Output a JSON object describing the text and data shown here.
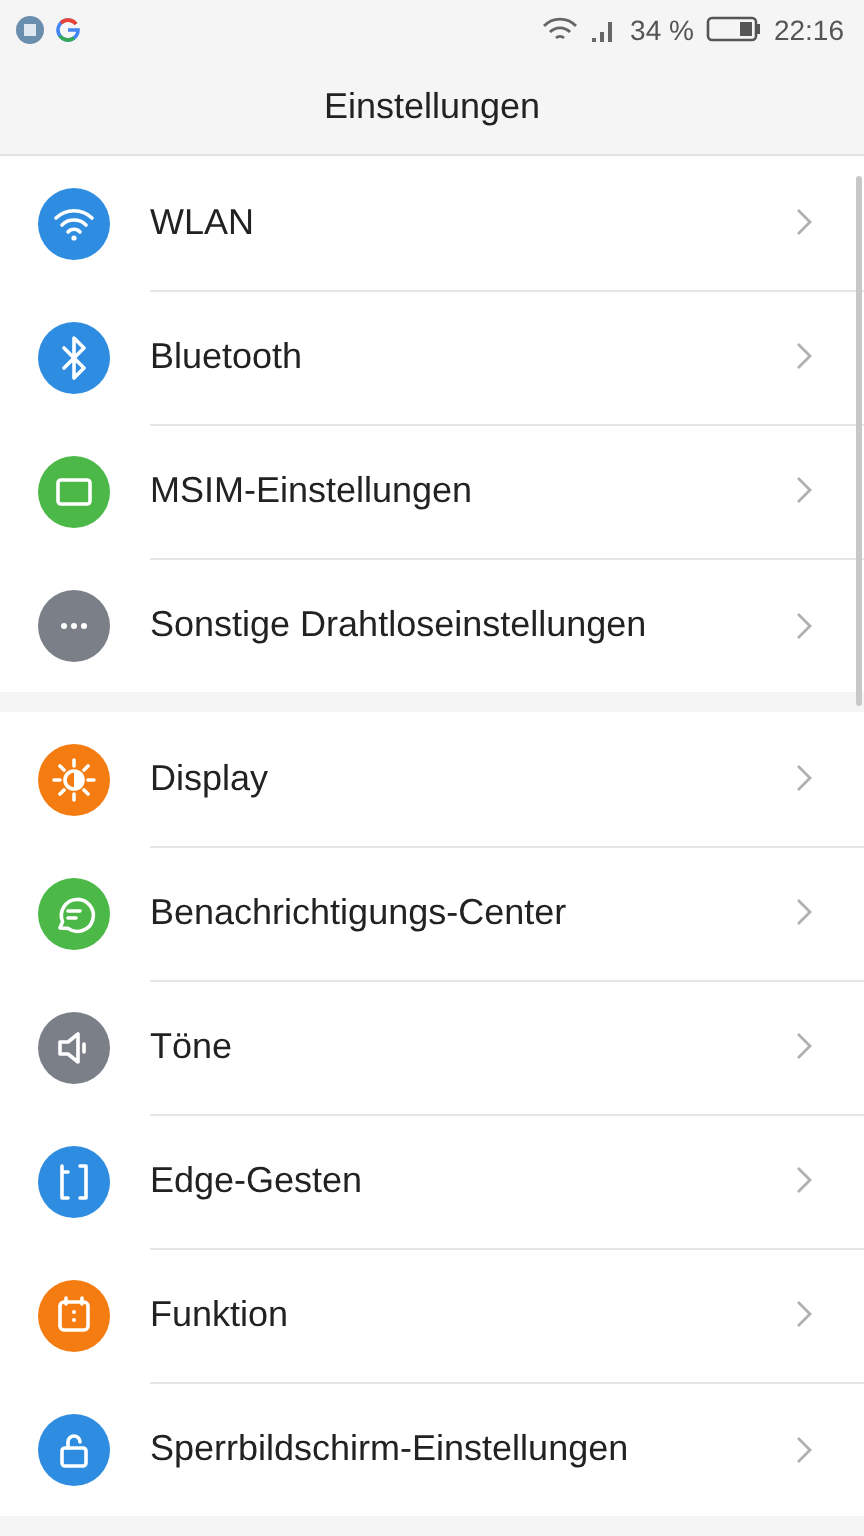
{
  "status_bar": {
    "battery_text": "34 %",
    "time": "22:16"
  },
  "header": {
    "title": "Einstellungen"
  },
  "sections": [
    {
      "items": [
        {
          "label": "WLAN",
          "color": "#2e8de0"
        },
        {
          "label": "Bluetooth",
          "color": "#2e8de0"
        },
        {
          "label": "MSIM-Einstellungen",
          "color": "#4cb848"
        },
        {
          "label": "Sonstige Drahtloseinstellungen",
          "color": "#7b8088"
        }
      ]
    },
    {
      "items": [
        {
          "label": "Display",
          "color": "#f57c10"
        },
        {
          "label": "Benachrichtigungs-Center",
          "color": "#4cb848"
        },
        {
          "label": "Töne",
          "color": "#7b8088"
        },
        {
          "label": "Edge-Gesten",
          "color": "#2e8de0"
        },
        {
          "label": "Funktion",
          "color": "#f57c10"
        },
        {
          "label": "Sperrbildschirm-Einstellungen",
          "color": "#2e8de0"
        }
      ]
    }
  ]
}
